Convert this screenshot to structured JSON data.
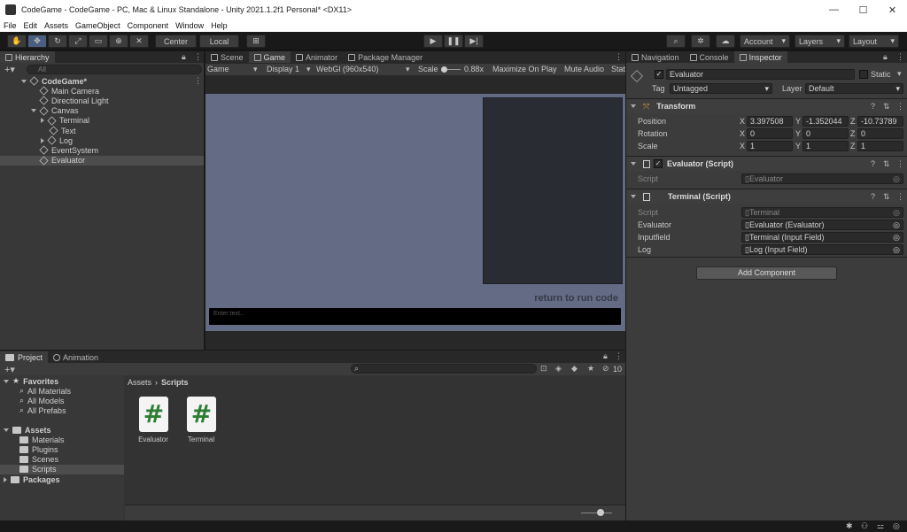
{
  "window": {
    "title": "CodeGame - CodeGame - PC, Mac & Linux Standalone - Unity 2021.1.2f1 Personal* <DX11>",
    "controls": [
      "—",
      "☐",
      "✕"
    ]
  },
  "menu": [
    "File",
    "Edit",
    "Assets",
    "GameObject",
    "Component",
    "Window",
    "Help"
  ],
  "toolbar": {
    "pivot_label": "Center",
    "space_label": "Local",
    "account_label": "Account",
    "layers_label": "Layers",
    "layout_label": "Layout"
  },
  "hierarchy": {
    "tab": "Hierarchy",
    "search_placeholder": "All",
    "items": [
      {
        "label": "CodeGame*",
        "depth": 0,
        "arrow": "down",
        "bold": true
      },
      {
        "label": "Main Camera",
        "depth": 1,
        "arrow": ""
      },
      {
        "label": "Directional Light",
        "depth": 1,
        "arrow": ""
      },
      {
        "label": "Canvas",
        "depth": 1,
        "arrow": "down"
      },
      {
        "label": "Terminal",
        "depth": 2,
        "arrow": "right"
      },
      {
        "label": "Text",
        "depth": 2,
        "arrow": ""
      },
      {
        "label": "Log",
        "depth": 2,
        "arrow": "right"
      },
      {
        "label": "EventSystem",
        "depth": 1,
        "arrow": ""
      },
      {
        "label": "Evaluator",
        "depth": 1,
        "arrow": "",
        "selected": true
      }
    ]
  },
  "game": {
    "tabs": [
      "Scene",
      "Game",
      "Animator",
      "Package Manager"
    ],
    "selected_tab": "Game",
    "view_mode": "Game",
    "display": "Display 1",
    "resolution": "WebGl (960x540)",
    "scale_label": "Scale",
    "scale_value": "0.88x",
    "maximize_label": "Maximize On Play",
    "mute_label": "Mute Audio",
    "stats_label": "Stat",
    "hint_text": "return to run code",
    "input_placeholder": "Enter text..."
  },
  "inspector": {
    "tabs": [
      "Navigation",
      "Console",
      "Inspector"
    ],
    "selected_tab": "Inspector",
    "object_name": "Evaluator",
    "static_label": "Static",
    "tag_label": "Tag",
    "tag_value": "Untagged",
    "layer_label": "Layer",
    "layer_value": "Default",
    "transform": {
      "title": "Transform",
      "rows": [
        {
          "label": "Position",
          "x": "3.397508",
          "y": "-1.352044",
          "z": "-10.73789"
        },
        {
          "label": "Rotation",
          "x": "0",
          "y": "0",
          "z": "0"
        },
        {
          "label": "Scale",
          "x": "1",
          "y": "1",
          "z": "1"
        }
      ]
    },
    "evaluator_script": {
      "title": "Evaluator (Script)",
      "script_label": "Script",
      "script_value": "Evaluator"
    },
    "terminal_script": {
      "title": "Terminal (Script)",
      "rows": [
        {
          "label": "Script",
          "value": "Terminal"
        },
        {
          "label": "Evaluator",
          "value": "Evaluator (Evaluator)"
        },
        {
          "label": "Inputfield",
          "value": "Terminal (Input Field)"
        },
        {
          "label": "Log",
          "value": "Log (Input Field)"
        }
      ]
    },
    "add_component_label": "Add Component"
  },
  "project": {
    "tabs": [
      "Project",
      "Animation"
    ],
    "favorites_label": "Favorites",
    "favorites": [
      "All Materials",
      "All Models",
      "All Prefabs"
    ],
    "assets_label": "Assets",
    "asset_folders": [
      "Materials",
      "Plugins",
      "Scenes",
      "Scripts"
    ],
    "packages_label": "Packages",
    "breadcrumb": {
      "root": "Assets",
      "current": "Scripts"
    },
    "files": [
      "Evaluator",
      "Terminal"
    ],
    "hidden_count": "10"
  },
  "colors": {
    "game_bg": "#646b84",
    "panel_dark": "#2a2c34",
    "selection": "#4d4d4d"
  }
}
